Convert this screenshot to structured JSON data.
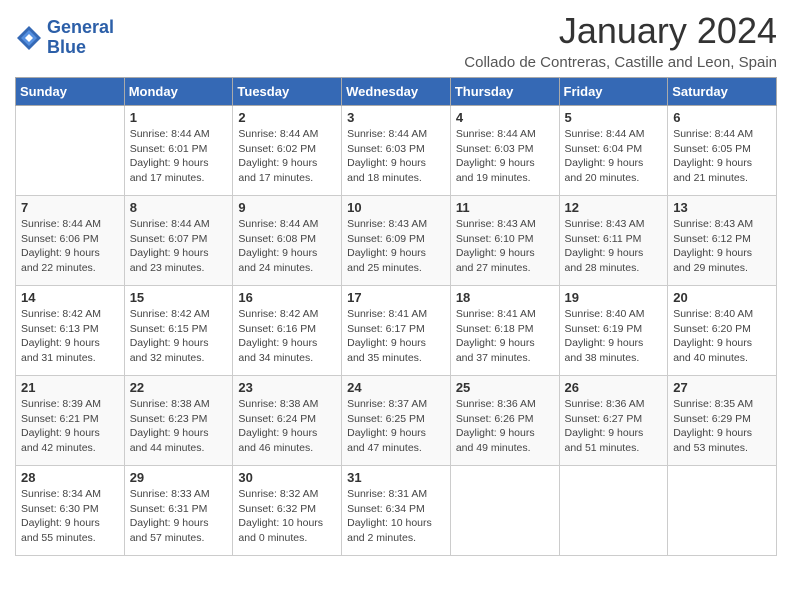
{
  "logo": {
    "line1": "General",
    "line2": "Blue"
  },
  "title": "January 2024",
  "subtitle": "Collado de Contreras, Castille and Leon, Spain",
  "headers": [
    "Sunday",
    "Monday",
    "Tuesday",
    "Wednesday",
    "Thursday",
    "Friday",
    "Saturday"
  ],
  "weeks": [
    [
      {
        "day": "",
        "info": ""
      },
      {
        "day": "1",
        "info": "Sunrise: 8:44 AM\nSunset: 6:01 PM\nDaylight: 9 hours\nand 17 minutes."
      },
      {
        "day": "2",
        "info": "Sunrise: 8:44 AM\nSunset: 6:02 PM\nDaylight: 9 hours\nand 17 minutes."
      },
      {
        "day": "3",
        "info": "Sunrise: 8:44 AM\nSunset: 6:03 PM\nDaylight: 9 hours\nand 18 minutes."
      },
      {
        "day": "4",
        "info": "Sunrise: 8:44 AM\nSunset: 6:03 PM\nDaylight: 9 hours\nand 19 minutes."
      },
      {
        "day": "5",
        "info": "Sunrise: 8:44 AM\nSunset: 6:04 PM\nDaylight: 9 hours\nand 20 minutes."
      },
      {
        "day": "6",
        "info": "Sunrise: 8:44 AM\nSunset: 6:05 PM\nDaylight: 9 hours\nand 21 minutes."
      }
    ],
    [
      {
        "day": "7",
        "info": "Sunrise: 8:44 AM\nSunset: 6:06 PM\nDaylight: 9 hours\nand 22 minutes."
      },
      {
        "day": "8",
        "info": "Sunrise: 8:44 AM\nSunset: 6:07 PM\nDaylight: 9 hours\nand 23 minutes."
      },
      {
        "day": "9",
        "info": "Sunrise: 8:44 AM\nSunset: 6:08 PM\nDaylight: 9 hours\nand 24 minutes."
      },
      {
        "day": "10",
        "info": "Sunrise: 8:43 AM\nSunset: 6:09 PM\nDaylight: 9 hours\nand 25 minutes."
      },
      {
        "day": "11",
        "info": "Sunrise: 8:43 AM\nSunset: 6:10 PM\nDaylight: 9 hours\nand 27 minutes."
      },
      {
        "day": "12",
        "info": "Sunrise: 8:43 AM\nSunset: 6:11 PM\nDaylight: 9 hours\nand 28 minutes."
      },
      {
        "day": "13",
        "info": "Sunrise: 8:43 AM\nSunset: 6:12 PM\nDaylight: 9 hours\nand 29 minutes."
      }
    ],
    [
      {
        "day": "14",
        "info": "Sunrise: 8:42 AM\nSunset: 6:13 PM\nDaylight: 9 hours\nand 31 minutes."
      },
      {
        "day": "15",
        "info": "Sunrise: 8:42 AM\nSunset: 6:15 PM\nDaylight: 9 hours\nand 32 minutes."
      },
      {
        "day": "16",
        "info": "Sunrise: 8:42 AM\nSunset: 6:16 PM\nDaylight: 9 hours\nand 34 minutes."
      },
      {
        "day": "17",
        "info": "Sunrise: 8:41 AM\nSunset: 6:17 PM\nDaylight: 9 hours\nand 35 minutes."
      },
      {
        "day": "18",
        "info": "Sunrise: 8:41 AM\nSunset: 6:18 PM\nDaylight: 9 hours\nand 37 minutes."
      },
      {
        "day": "19",
        "info": "Sunrise: 8:40 AM\nSunset: 6:19 PM\nDaylight: 9 hours\nand 38 minutes."
      },
      {
        "day": "20",
        "info": "Sunrise: 8:40 AM\nSunset: 6:20 PM\nDaylight: 9 hours\nand 40 minutes."
      }
    ],
    [
      {
        "day": "21",
        "info": "Sunrise: 8:39 AM\nSunset: 6:21 PM\nDaylight: 9 hours\nand 42 minutes."
      },
      {
        "day": "22",
        "info": "Sunrise: 8:38 AM\nSunset: 6:23 PM\nDaylight: 9 hours\nand 44 minutes."
      },
      {
        "day": "23",
        "info": "Sunrise: 8:38 AM\nSunset: 6:24 PM\nDaylight: 9 hours\nand 46 minutes."
      },
      {
        "day": "24",
        "info": "Sunrise: 8:37 AM\nSunset: 6:25 PM\nDaylight: 9 hours\nand 47 minutes."
      },
      {
        "day": "25",
        "info": "Sunrise: 8:36 AM\nSunset: 6:26 PM\nDaylight: 9 hours\nand 49 minutes."
      },
      {
        "day": "26",
        "info": "Sunrise: 8:36 AM\nSunset: 6:27 PM\nDaylight: 9 hours\nand 51 minutes."
      },
      {
        "day": "27",
        "info": "Sunrise: 8:35 AM\nSunset: 6:29 PM\nDaylight: 9 hours\nand 53 minutes."
      }
    ],
    [
      {
        "day": "28",
        "info": "Sunrise: 8:34 AM\nSunset: 6:30 PM\nDaylight: 9 hours\nand 55 minutes."
      },
      {
        "day": "29",
        "info": "Sunrise: 8:33 AM\nSunset: 6:31 PM\nDaylight: 9 hours\nand 57 minutes."
      },
      {
        "day": "30",
        "info": "Sunrise: 8:32 AM\nSunset: 6:32 PM\nDaylight: 10 hours\nand 0 minutes."
      },
      {
        "day": "31",
        "info": "Sunrise: 8:31 AM\nSunset: 6:34 PM\nDaylight: 10 hours\nand 2 minutes."
      },
      {
        "day": "",
        "info": ""
      },
      {
        "day": "",
        "info": ""
      },
      {
        "day": "",
        "info": ""
      }
    ]
  ]
}
